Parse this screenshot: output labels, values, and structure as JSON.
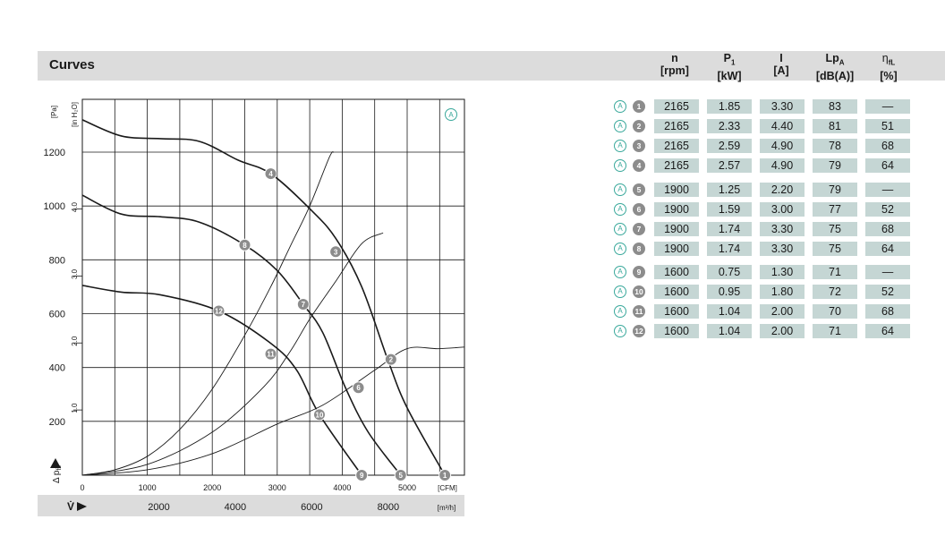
{
  "header": {
    "title": "Curves"
  },
  "columns": [
    {
      "key": "n",
      "top": "n",
      "bottom": "[rpm]"
    },
    {
      "key": "p1",
      "top": "P",
      "sub": "1",
      "bottom": "[kW]"
    },
    {
      "key": "i",
      "top": "I",
      "bottom": "[A]"
    },
    {
      "key": "lpa",
      "top": "Lp",
      "sub": "A",
      "bottom": "[dB(A)]"
    },
    {
      "key": "eta",
      "top": "η",
      "sub": "fL",
      "bottom": "[%]"
    }
  ],
  "rows": [
    {
      "marker": "A",
      "id": "1",
      "n": "2165",
      "p1": "1.85",
      "i": "3.30",
      "lpa": "83",
      "eta": "—"
    },
    {
      "marker": "A",
      "id": "2",
      "n": "2165",
      "p1": "2.33",
      "i": "4.40",
      "lpa": "81",
      "eta": "51"
    },
    {
      "marker": "A",
      "id": "3",
      "n": "2165",
      "p1": "2.59",
      "i": "4.90",
      "lpa": "78",
      "eta": "68"
    },
    {
      "marker": "A",
      "id": "4",
      "n": "2165",
      "p1": "2.57",
      "i": "4.90",
      "lpa": "79",
      "eta": "64"
    },
    {
      "marker": "A",
      "id": "5",
      "n": "1900",
      "p1": "1.25",
      "i": "2.20",
      "lpa": "79",
      "eta": "—"
    },
    {
      "marker": "A",
      "id": "6",
      "n": "1900",
      "p1": "1.59",
      "i": "3.00",
      "lpa": "77",
      "eta": "52"
    },
    {
      "marker": "A",
      "id": "7",
      "n": "1900",
      "p1": "1.74",
      "i": "3.30",
      "lpa": "75",
      "eta": "68"
    },
    {
      "marker": "A",
      "id": "8",
      "n": "1900",
      "p1": "1.74",
      "i": "3.30",
      "lpa": "75",
      "eta": "64"
    },
    {
      "marker": "A",
      "id": "9",
      "n": "1600",
      "p1": "0.75",
      "i": "1.30",
      "lpa": "71",
      "eta": "—"
    },
    {
      "marker": "A",
      "id": "10",
      "n": "1600",
      "p1": "0.95",
      "i": "1.80",
      "lpa": "72",
      "eta": "52"
    },
    {
      "marker": "A",
      "id": "11",
      "n": "1600",
      "p1": "1.04",
      "i": "2.00",
      "lpa": "70",
      "eta": "68"
    },
    {
      "marker": "A",
      "id": "12",
      "n": "1600",
      "p1": "1.04",
      "i": "2.00",
      "lpa": "71",
      "eta": "64"
    }
  ],
  "chart_data": {
    "type": "line",
    "badge": "A",
    "y_unit": "[Pa]",
    "y2_unit": "[in H₂O]",
    "y_label": "Δ p",
    "y_label_sub": "fs",
    "x_label": "V̇",
    "x_unit_cfm": "[CFM]",
    "x_unit_m3h": "[m³/h]",
    "ylim": [
      0,
      1400
    ],
    "xlim_cfm": [
      0,
      6000
    ],
    "y_ticks_pa": [
      200,
      400,
      600,
      800,
      1000,
      1200
    ],
    "y_ticks_inh2o": [
      "1.0",
      "2.0",
      "3.0",
      "4.0"
    ],
    "x_ticks_cfm": [
      0,
      1000,
      2000,
      3000,
      4000,
      5000
    ],
    "x_ticks_m3h": [
      2000,
      4000,
      6000,
      8000
    ],
    "grid": true,
    "fan_curves": [
      {
        "rpm": 2165,
        "points": [
          [
            0,
            1320
          ],
          [
            600,
            1260
          ],
          [
            1200,
            1250
          ],
          [
            1800,
            1240
          ],
          [
            2400,
            1170
          ],
          [
            2900,
            1120
          ],
          [
            3500,
            990
          ],
          [
            3900,
            880
          ],
          [
            4300,
            700
          ],
          [
            4700,
            430
          ],
          [
            5000,
            250
          ],
          [
            5580,
            0
          ]
        ]
      },
      {
        "rpm": 1900,
        "points": [
          [
            0,
            1040
          ],
          [
            600,
            970
          ],
          [
            1200,
            960
          ],
          [
            1800,
            940
          ],
          [
            2500,
            855
          ],
          [
            3000,
            760
          ],
          [
            3400,
            635
          ],
          [
            3700,
            530
          ],
          [
            4050,
            325
          ],
          [
            4400,
            160
          ],
          [
            4900,
            0
          ]
        ]
      },
      {
        "rpm": 1600,
        "points": [
          [
            0,
            705
          ],
          [
            600,
            680
          ],
          [
            1200,
            670
          ],
          [
            2100,
            610
          ],
          [
            2900,
            490
          ],
          [
            3300,
            390
          ],
          [
            3650,
            225
          ],
          [
            4300,
            0
          ]
        ]
      }
    ],
    "system_curves": [
      {
        "points": [
          [
            0,
            0
          ],
          [
            500,
            20
          ],
          [
            1000,
            70
          ],
          [
            1500,
            170
          ],
          [
            2000,
            320
          ],
          [
            2500,
            520
          ],
          [
            2900,
            700
          ],
          [
            3200,
            850
          ],
          [
            3500,
            1000
          ],
          [
            3800,
            1180
          ],
          [
            3870,
            1200
          ]
        ]
      },
      {
        "points": [
          [
            0,
            0
          ],
          [
            1000,
            40
          ],
          [
            2000,
            160
          ],
          [
            2800,
            330
          ],
          [
            3200,
            460
          ],
          [
            3500,
            580
          ],
          [
            3900,
            720
          ],
          [
            4300,
            860
          ],
          [
            4630,
            900
          ]
        ]
      },
      {
        "points": [
          [
            0,
            0
          ],
          [
            1000,
            20
          ],
          [
            2000,
            80
          ],
          [
            3000,
            190
          ],
          [
            3700,
            260
          ],
          [
            4500,
            390
          ],
          [
            5000,
            470
          ],
          [
            5500,
            470
          ],
          [
            6100,
            480
          ]
        ]
      }
    ],
    "operating_points": [
      {
        "id": "1",
        "cfm": 5580,
        "pa": 0
      },
      {
        "id": "2",
        "cfm": 4750,
        "pa": 430
      },
      {
        "id": "3",
        "cfm": 3900,
        "pa": 830
      },
      {
        "id": "4",
        "cfm": 2900,
        "pa": 1120
      },
      {
        "id": "5",
        "cfm": 4900,
        "pa": 0
      },
      {
        "id": "6",
        "cfm": 4250,
        "pa": 325
      },
      {
        "id": "7",
        "cfm": 3400,
        "pa": 635
      },
      {
        "id": "8",
        "cfm": 2500,
        "pa": 855
      },
      {
        "id": "9",
        "cfm": 4300,
        "pa": 0
      },
      {
        "id": "10",
        "cfm": 3650,
        "pa": 225
      },
      {
        "id": "11",
        "cfm": 2900,
        "pa": 450
      },
      {
        "id": "12",
        "cfm": 2100,
        "pa": 610
      }
    ]
  }
}
